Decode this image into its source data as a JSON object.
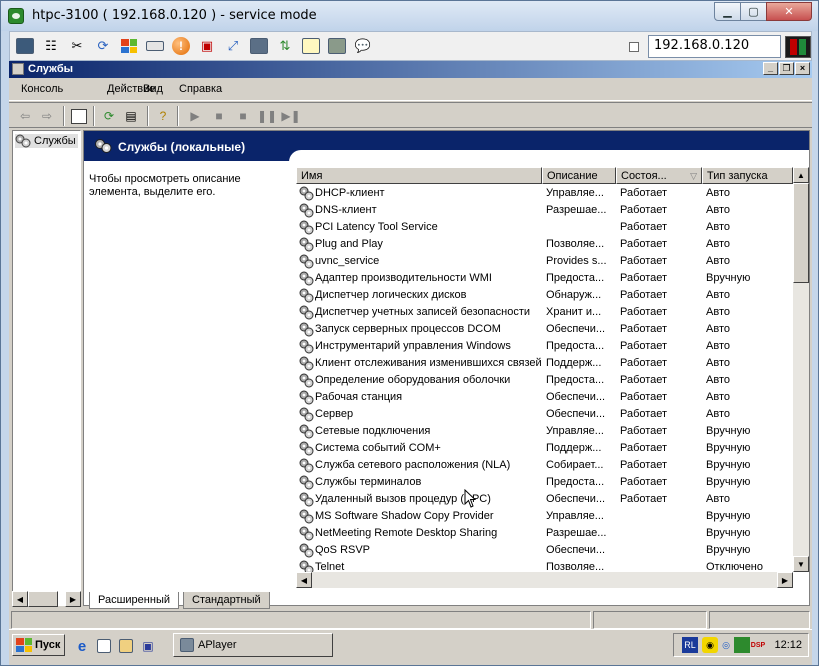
{
  "vnc": {
    "title": "htpc-3100 ( 192.168.0.120 ) - service mode",
    "host": "192.168.0.120",
    "colors": {
      "status_red": "#c00000",
      "status_green": "#1f8a3a"
    }
  },
  "mmc": {
    "title": "Службы",
    "menu": [
      "Консоль",
      "Действие",
      "Вид",
      "Справка"
    ],
    "tree": {
      "root_label": "Службы"
    },
    "header_title": "Службы (локальные)",
    "description": "Чтобы просмотреть описание элемента, выделите его.",
    "columns": [
      "Имя",
      "Описание",
      "Состоя...",
      "Тип запуска"
    ],
    "services": [
      {
        "name": "DHCP-клиент",
        "desc": "Управляе...",
        "status": "Работает",
        "startup": "Авто"
      },
      {
        "name": "DNS-клиент",
        "desc": "Разрешае...",
        "status": "Работает",
        "startup": "Авто"
      },
      {
        "name": "PCI Latency Tool Service",
        "desc": "",
        "status": "Работает",
        "startup": "Авто"
      },
      {
        "name": "Plug and Play",
        "desc": "Позволяе...",
        "status": "Работает",
        "startup": "Авто"
      },
      {
        "name": "uvnc_service",
        "desc": "Provides s...",
        "status": "Работает",
        "startup": "Авто"
      },
      {
        "name": "Адаптер производительности WMI",
        "desc": "Предоста...",
        "status": "Работает",
        "startup": "Вручную"
      },
      {
        "name": "Диспетчер логических дисков",
        "desc": "Обнаруж...",
        "status": "Работает",
        "startup": "Авто"
      },
      {
        "name": "Диспетчер учетных записей безопасности",
        "desc": "Хранит и...",
        "status": "Работает",
        "startup": "Авто"
      },
      {
        "name": "Запуск серверных процессов DCOM",
        "desc": "Обеспечи...",
        "status": "Работает",
        "startup": "Авто"
      },
      {
        "name": "Инструментарий управления Windows",
        "desc": "Предоста...",
        "status": "Работает",
        "startup": "Авто"
      },
      {
        "name": "Клиент отслеживания изменившихся связей",
        "desc": "Поддерж...",
        "status": "Работает",
        "startup": "Авто"
      },
      {
        "name": "Определение оборудования оболочки",
        "desc": "Предоста...",
        "status": "Работает",
        "startup": "Авто"
      },
      {
        "name": "Рабочая станция",
        "desc": "Обеспечи...",
        "status": "Работает",
        "startup": "Авто"
      },
      {
        "name": "Сервер",
        "desc": "Обеспечи...",
        "status": "Работает",
        "startup": "Авто"
      },
      {
        "name": "Сетевые подключения",
        "desc": "Управляе...",
        "status": "Работает",
        "startup": "Вручную"
      },
      {
        "name": "Система событий COM+",
        "desc": "Поддерж...",
        "status": "Работает",
        "startup": "Вручную"
      },
      {
        "name": "Служба сетевого расположения (NLA)",
        "desc": "Собирает...",
        "status": "Работает",
        "startup": "Вручную"
      },
      {
        "name": "Службы терминалов",
        "desc": "Предоста...",
        "status": "Работает",
        "startup": "Вручную"
      },
      {
        "name": "Удаленный вызов процедур (RPC)",
        "desc": "Обеспечи...",
        "status": "Работает",
        "startup": "Авто"
      },
      {
        "name": "MS Software Shadow Copy Provider",
        "desc": "Управляе...",
        "status": "",
        "startup": "Вручную"
      },
      {
        "name": "NetMeeting Remote Desktop Sharing",
        "desc": "Разрешае...",
        "status": "",
        "startup": "Вручную"
      },
      {
        "name": "QoS RSVP",
        "desc": "Обеспечи...",
        "status": "",
        "startup": "Вручную"
      },
      {
        "name": "Telnet",
        "desc": "Позволяе...",
        "status": "",
        "startup": "Отключено"
      }
    ],
    "tabs": [
      "Расширенный",
      "Стандартный"
    ]
  },
  "taskbar": {
    "start_label": "Пуск",
    "task_label": "APlayer",
    "tray_lang": "RL",
    "tray_dsp": "DSP",
    "clock": "12:12"
  },
  "icons": {
    "vnc_toolbar": [
      "monitor-icon",
      "hierarchy-icon",
      "tools-icon",
      "refresh-icon",
      "windows-icon",
      "keyboard-icon",
      "alert-icon",
      "disconnect-icon",
      "fullscreen-icon",
      "screen-icon",
      "transfer-icon",
      "note-icon",
      "zoom-icon",
      "chat-icon"
    ]
  }
}
